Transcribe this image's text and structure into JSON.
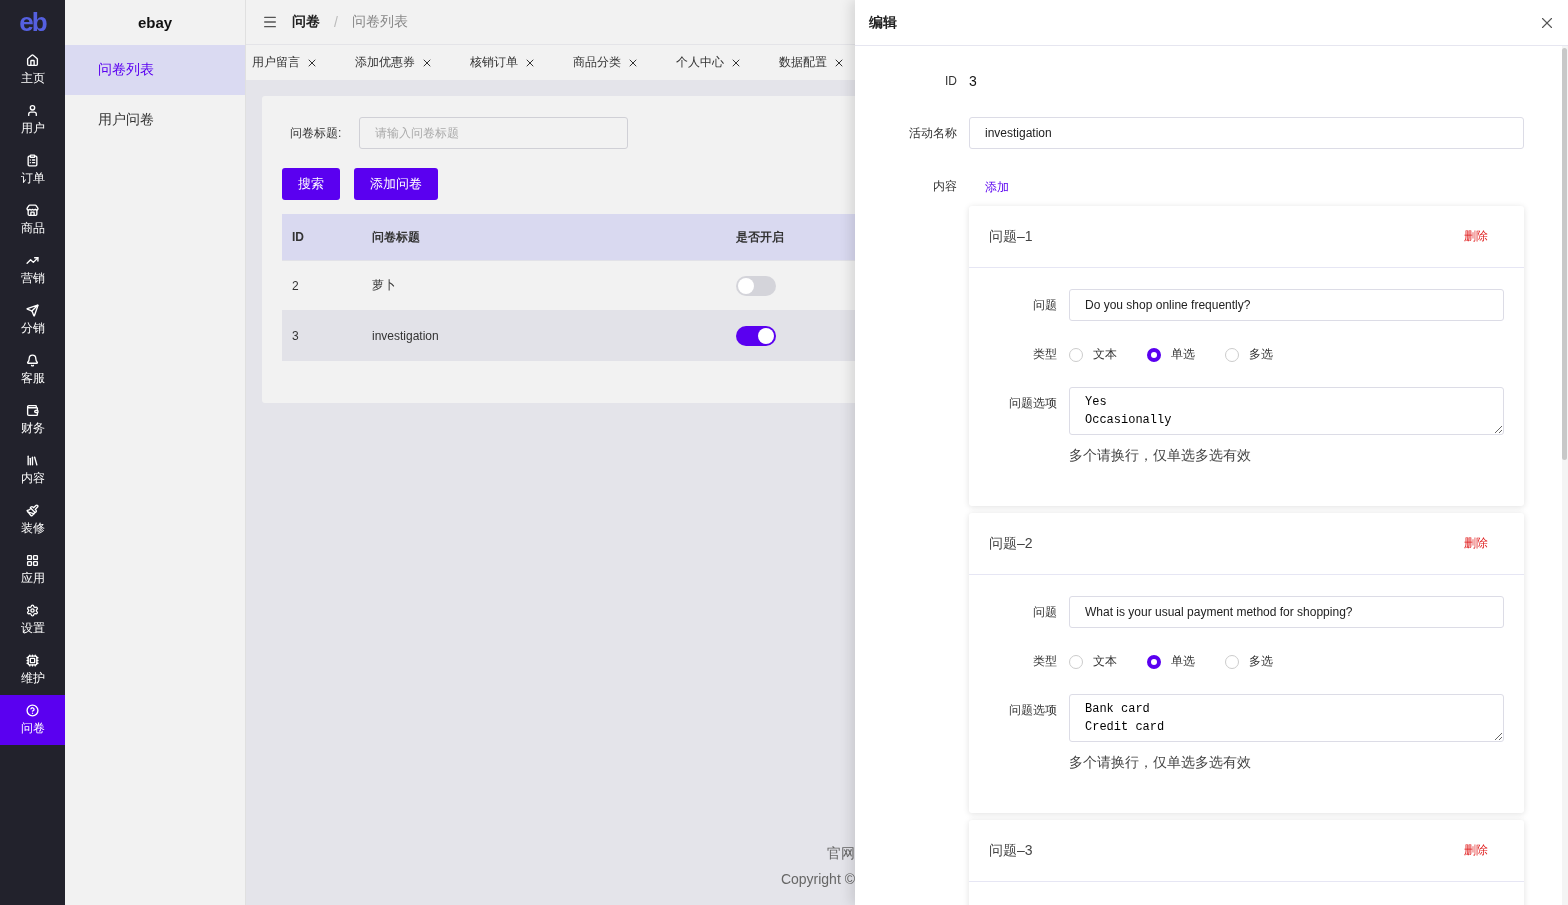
{
  "nav": {
    "logo": "eb",
    "items": [
      {
        "label": "主页",
        "selected": false
      },
      {
        "label": "用户",
        "selected": false
      },
      {
        "label": "订单",
        "selected": false
      },
      {
        "label": "商品",
        "selected": false
      },
      {
        "label": "营销",
        "selected": false
      },
      {
        "label": "分销",
        "selected": false
      },
      {
        "label": "客服",
        "selected": false
      },
      {
        "label": "财务",
        "selected": false
      },
      {
        "label": "内容",
        "selected": false
      },
      {
        "label": "装修",
        "selected": false
      },
      {
        "label": "应用",
        "selected": false
      },
      {
        "label": "设置",
        "selected": false
      },
      {
        "label": "维护",
        "selected": false
      },
      {
        "label": "问卷",
        "selected": true
      }
    ]
  },
  "submenu": {
    "title": "ebay",
    "items": [
      {
        "label": "问卷列表",
        "selected": true
      },
      {
        "label": "用户问卷",
        "selected": false
      }
    ]
  },
  "breadcrumb": [
    "问卷",
    "问卷列表"
  ],
  "breadcrumb_separator": "/",
  "tabs": [
    {
      "label": "用户留言"
    },
    {
      "label": "添加优惠券"
    },
    {
      "label": "核销订单"
    },
    {
      "label": "商品分类"
    },
    {
      "label": "个人中心"
    },
    {
      "label": "数据配置"
    }
  ],
  "search": {
    "label": "问卷标题:",
    "placeholder": "请输入问卷标题"
  },
  "buttons": [
    "搜索",
    "添加问卷"
  ],
  "table": {
    "columns": [
      "ID",
      "问卷标题",
      "是否开启"
    ],
    "rows": [
      {
        "id": "2",
        "title": "萝卜",
        "on": false,
        "selected": false
      },
      {
        "id": "3",
        "title": "investigation",
        "on": true,
        "selected": true
      }
    ]
  },
  "footer": [
    "官网",
    "Copyright ©"
  ],
  "drawer": {
    "title": "编辑",
    "id_label": "ID",
    "id": "3",
    "name_label": "活动名称",
    "name": "investigation",
    "content_label": "内容",
    "add": "添加",
    "questions": [
      {
        "title": "问题–1",
        "delete": "删除",
        "question_label": "问题",
        "question": "Do you shop online frequently?",
        "type_label": "类型",
        "types": [
          {
            "label": "文本",
            "selected": false
          },
          {
            "label": "单选",
            "selected": true
          },
          {
            "label": "多选",
            "selected": false
          }
        ],
        "options_label": "问题选项",
        "options": "Yes\nOccasionally",
        "hint": "多个请换行，仅单选多选有效"
      },
      {
        "title": "问题–2",
        "delete": "删除",
        "question_label": "问题",
        "question": "What is your usual payment method for shopping?",
        "type_label": "类型",
        "types": [
          {
            "label": "文本",
            "selected": false
          },
          {
            "label": "单选",
            "selected": true
          },
          {
            "label": "多选",
            "selected": false
          }
        ],
        "options_label": "问题选项",
        "options": "Bank card\nCredit card",
        "hint": "多个请换行，仅单选多选有效"
      },
      {
        "title": "问题–3",
        "delete": "删除"
      }
    ]
  }
}
